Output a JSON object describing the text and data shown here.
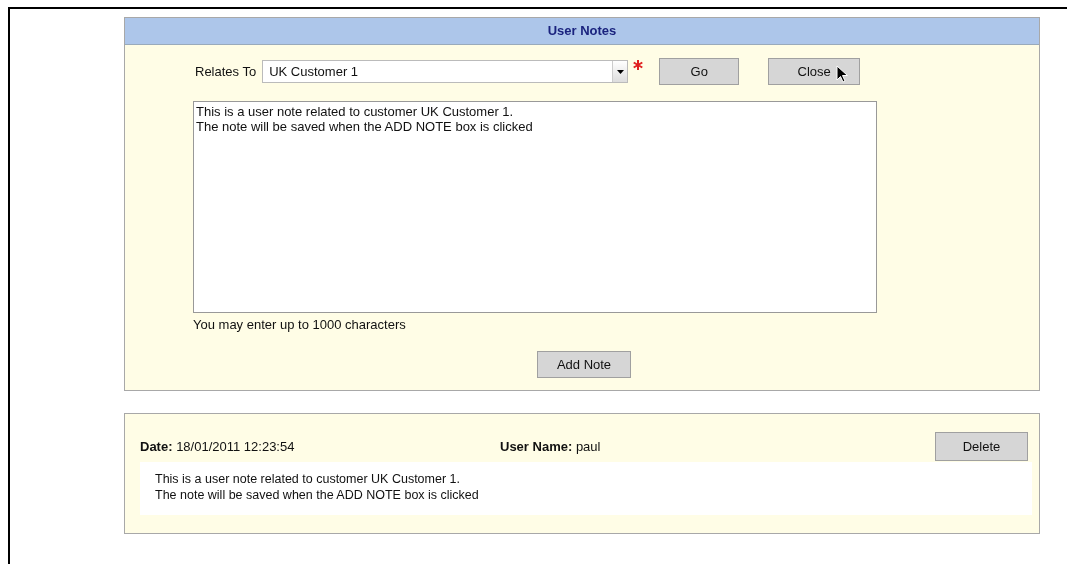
{
  "panel": {
    "title": "User Notes",
    "relates_to": {
      "label": "Relates To",
      "value": "UK Customer 1",
      "required": true
    },
    "buttons": [
      "Go",
      "Close"
    ],
    "note_lines": [
      "This is a user note related to customer UK Customer 1.",
      "The note will be saved when the ADD NOTE box is clicked"
    ],
    "hint": "You may enter up to 1000 characters",
    "add_button": "Add Note"
  },
  "notes": [
    {
      "date": "**Date:** 18/01/2011 12:23:54",
      "user": "**User Name:** paul",
      "delete_button": "Delete",
      "lines": [
        "This is a user note related to customer UK Customer 1.",
        "The note will be saved when the ADD NOTE box is clicked"
      ]
    }
  ]
}
